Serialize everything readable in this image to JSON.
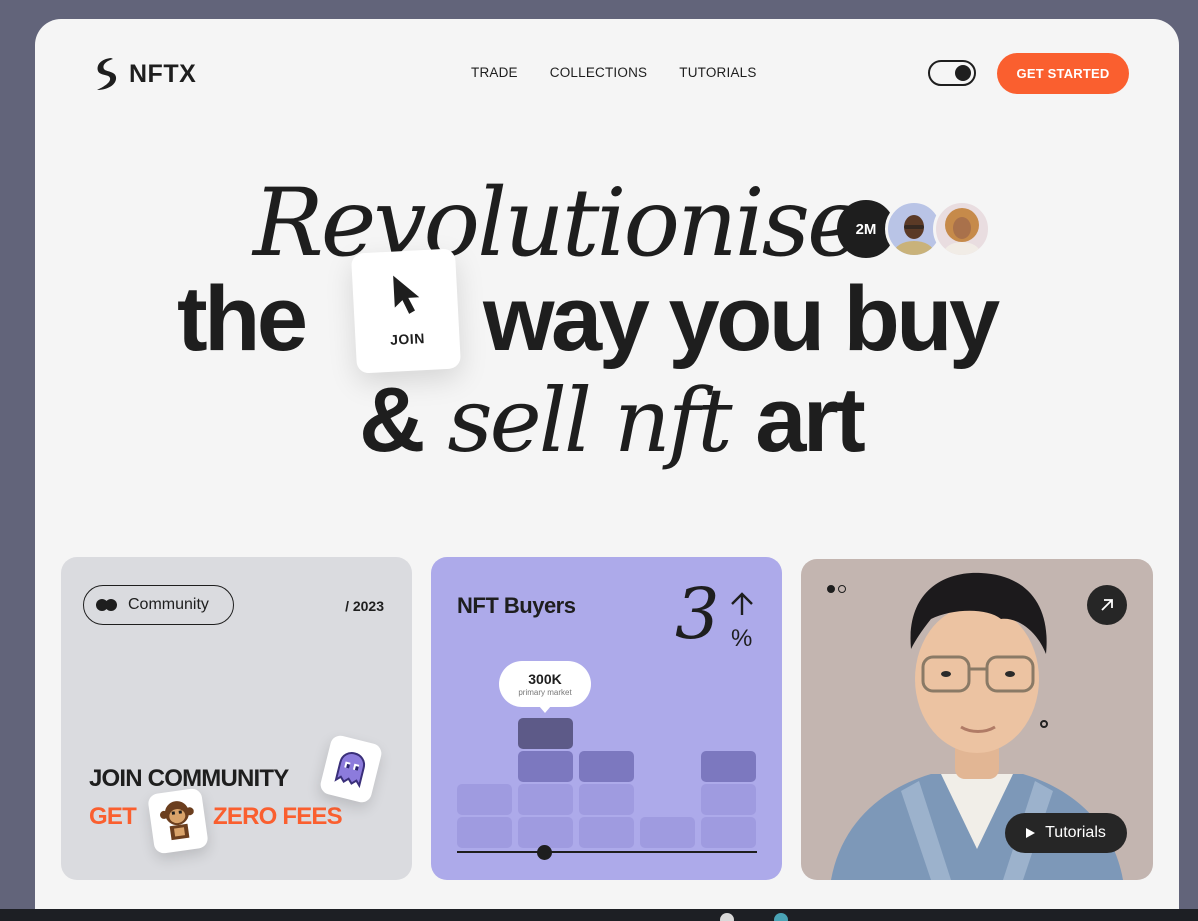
{
  "brand": {
    "name": "NFTX"
  },
  "nav": {
    "items": [
      "TRADE",
      "COLLECTIONS",
      "TUTORIALS"
    ]
  },
  "header": {
    "cta_label": "GET STARTED",
    "theme_toggle": "on"
  },
  "hero": {
    "line1": "Revolutionise",
    "line2a": "the",
    "line2b": "way you buy",
    "line3_amp": "&",
    "line3_sell": "sell nft",
    "line3_art": "art",
    "users_count": "2M",
    "join_label": "JOIN"
  },
  "cards": {
    "community": {
      "pill_label": "Community",
      "year": "/ 2023",
      "headline": "JOIN COMMUNITY",
      "get": "GET",
      "zero_fees": "ZERO FEES"
    },
    "buyers": {
      "title": "NFT Buyers",
      "stat_value": "3",
      "stat_unit": "%",
      "bubble_value": "300K",
      "bubble_sub": "primary market",
      "column_levels": [
        2,
        4,
        3,
        1,
        3
      ],
      "highlight_column": 1,
      "colors": {
        "base": "#9f9be0",
        "mid": "#7c78bf",
        "top": "#5d5a88"
      }
    },
    "profile": {
      "carousel_dots": 2,
      "carousel_active": 0,
      "tutorials_label": "Tutorials"
    }
  },
  "colors": {
    "accent": "#fa5f2f",
    "dark": "#1e1e1e",
    "frame_bg": "#f5f5f5",
    "backdrop": "#62647a"
  }
}
